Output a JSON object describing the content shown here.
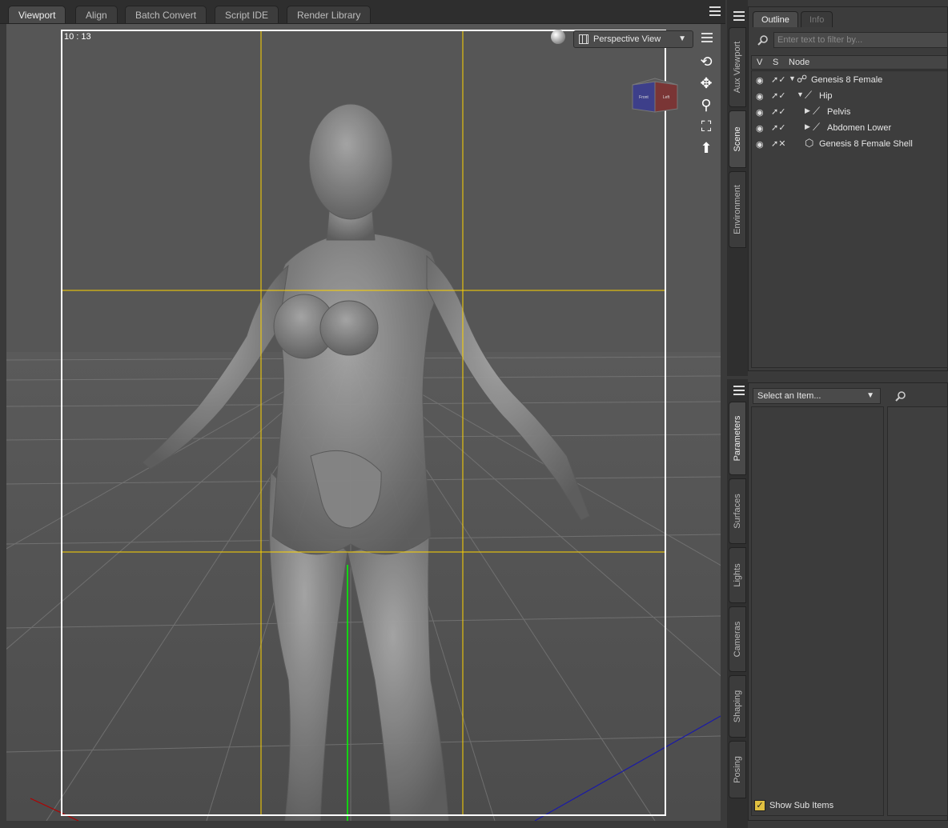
{
  "tabs": [
    {
      "label": "Viewport",
      "active": true
    },
    {
      "label": "Align",
      "active": false
    },
    {
      "label": "Batch Convert",
      "active": false
    },
    {
      "label": "Script IDE",
      "active": false
    },
    {
      "label": "Render Library",
      "active": false
    }
  ],
  "viewport": {
    "aspect_ratio": "10 : 13",
    "view_selector": "Perspective View",
    "nav_tools": [
      "orbit-icon",
      "pan-icon",
      "zoom-icon",
      "frame-icon",
      "reset-icon"
    ],
    "cube_faces": [
      "Front",
      "Left"
    ],
    "colors": {
      "grid_lines": "#ffd400",
      "y_axis": "#00ff00",
      "x_axis": "#b00000",
      "z_axis": "#1a1aa8"
    }
  },
  "side_tabs_top": [
    {
      "label": "Aux Viewport",
      "active": false
    },
    {
      "label": "Scene",
      "active": true
    },
    {
      "label": "Environment",
      "active": false
    }
  ],
  "side_tabs_bottom": [
    {
      "label": "Parameters",
      "active": true
    },
    {
      "label": "Surfaces",
      "active": false
    },
    {
      "label": "Lights",
      "active": false
    },
    {
      "label": "Cameras",
      "active": false
    },
    {
      "label": "Shaping",
      "active": false
    },
    {
      "label": "Posing",
      "active": false
    }
  ],
  "scene": {
    "subtabs": [
      {
        "label": "Outline",
        "active": true
      },
      {
        "label": "Info",
        "active": false
      }
    ],
    "filter_placeholder": "Enter text to filter by...",
    "columns": [
      "V",
      "S",
      "Node"
    ],
    "nodes": [
      {
        "label": "Genesis 8 Female",
        "icon": "figure-icon",
        "expanded": true,
        "depth": 0
      },
      {
        "label": "Hip",
        "icon": "bone-icon",
        "expanded": true,
        "depth": 1
      },
      {
        "label": "Pelvis",
        "icon": "bone-icon",
        "expanded": false,
        "depth": 2
      },
      {
        "label": "Abdomen Lower",
        "icon": "bone-icon",
        "expanded": false,
        "depth": 2
      },
      {
        "label": "Genesis 8 Female Shell",
        "icon": "shell-icon",
        "expanded": false,
        "depth": 1
      }
    ]
  },
  "parameters": {
    "select_placeholder": "Select an Item...",
    "show_sub_items_label": "Show Sub Items",
    "show_sub_items_checked": true
  }
}
